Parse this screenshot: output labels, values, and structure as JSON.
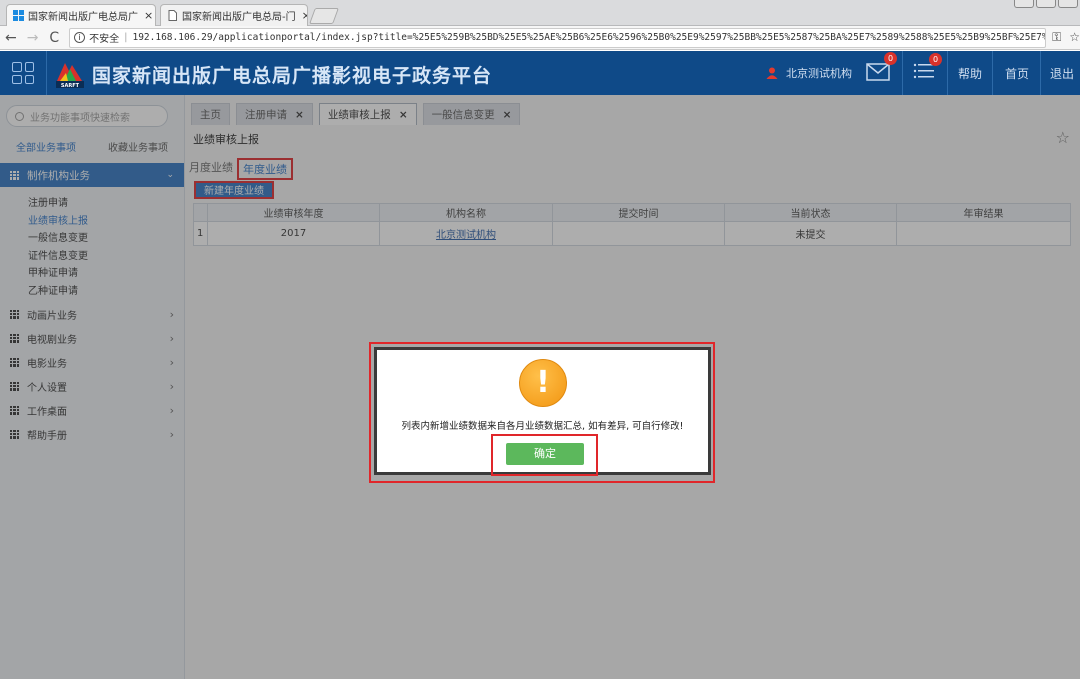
{
  "browser": {
    "tabs": [
      {
        "title": "国家新闻出版广电总局广",
        "icon": "windows-icon",
        "active": true
      },
      {
        "title": "国家新闻出版广电总局-门",
        "icon": "page-icon",
        "active": false
      }
    ],
    "close_glyph": "×",
    "security_label": "不安全",
    "url": "192.168.106.29/applicationportal/index.jsp?title=%25E5%259B%25BD%25E5%25AE%25B6%25E6%2596%25B0%25E9%2597%25BB%25E5%2587%25BA%25E7%2589%2588%25E5%25B9%25BF%25E7%259…"
  },
  "header": {
    "title": "国家新闻出版广电总局广播影视电子政务平台",
    "logo_text": "SARFT",
    "user_name": "北京测试机构",
    "mail_badge": "0",
    "tasks_badge": "0",
    "help": "帮助",
    "home": "首页",
    "logout": "退出"
  },
  "sidebar": {
    "search_placeholder": "业务功能事项快速检索",
    "tabs": [
      "全部业务事项",
      "收藏业务事项"
    ],
    "active_group": "制作机构业务",
    "sub_items": [
      "注册申请",
      "业绩审核上报",
      "一般信息变更",
      "证件信息变更",
      "甲种证申请",
      "乙种证申请"
    ],
    "active_sub_index": 1,
    "groups": [
      "动画片业务",
      "电视剧业务",
      "电影业务",
      "个人设置",
      "工作桌面",
      "帮助手册"
    ]
  },
  "main": {
    "tabs": [
      {
        "label": "主页",
        "closable": false
      },
      {
        "label": "注册申请",
        "closable": true
      },
      {
        "label": "业绩审核上报",
        "closable": true,
        "active": true
      },
      {
        "label": "一般信息变更",
        "closable": true
      }
    ],
    "page_title": "业绩审核上报",
    "subtabs": [
      "月度业绩",
      "年度业绩"
    ],
    "new_button": "新建年度业绩",
    "table": {
      "columns": [
        "业绩审核年度",
        "机构名称",
        "提交时间",
        "当前状态",
        "年审结果"
      ],
      "rows": [
        {
          "index": "1",
          "year": "2017",
          "org": "北京测试机构",
          "submit_time": "",
          "status": "未提交",
          "result": ""
        }
      ]
    }
  },
  "dialog": {
    "icon": "warning-icon",
    "icon_glyph": "!",
    "message": "列表内新增业绩数据来自各月业绩数据汇总, 如有差异, 可自行修改!",
    "ok_button": "确定"
  },
  "colors": {
    "header_bg": "#0f4a88",
    "accent": "#2b73c2",
    "highlight": "#e0262a",
    "ok_green": "#5cb85c",
    "warning_orange": "#f29511"
  }
}
